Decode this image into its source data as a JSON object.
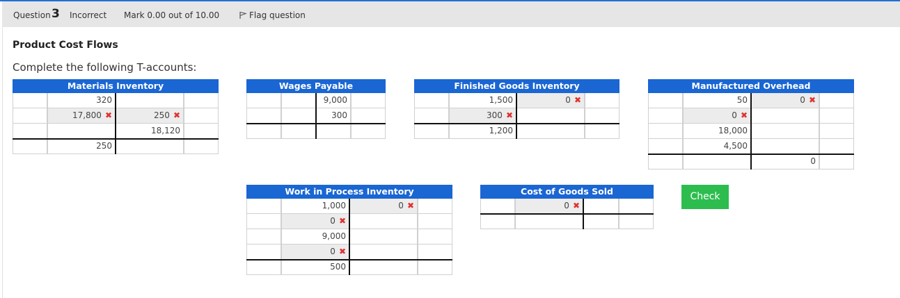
{
  "header": {
    "question_label": "Question",
    "question_number": "3",
    "status": "Incorrect",
    "mark": "Mark 0.00 out of 10.00",
    "flag_label": "Flag question"
  },
  "title": "Product Cost Flows",
  "instructions": "Complete the following T-accounts:",
  "incorrect_mark": "✖",
  "accounts": {
    "materials": {
      "name": "Materials Inventory",
      "rows": [
        {
          "left": "320",
          "right": ""
        },
        {
          "left": "17,800",
          "right": "250"
        },
        {
          "left": "",
          "right": "18,120"
        },
        {
          "left": "250",
          "right": ""
        }
      ]
    },
    "wages": {
      "name": "Wages Payable",
      "rows": [
        {
          "left": "",
          "right": "9,000"
        },
        {
          "left": "",
          "right": "300"
        },
        {
          "left": "",
          "right": ""
        }
      ]
    },
    "finished": {
      "name": "Finished Goods Inventory",
      "rows": [
        {
          "left": "1,500",
          "right": "0"
        },
        {
          "left": "300",
          "right": ""
        },
        {
          "left": "1,200",
          "right": ""
        }
      ]
    },
    "overhead": {
      "name": "Manufactured Overhead",
      "rows": [
        {
          "left": "50",
          "right": "0"
        },
        {
          "left": "0",
          "right": ""
        },
        {
          "left": "18,000",
          "right": ""
        },
        {
          "left": "4,500",
          "right": ""
        },
        {
          "left": "",
          "right": "0"
        }
      ]
    },
    "wip": {
      "name": "Work in Process Inventory",
      "rows": [
        {
          "left": "1,000",
          "right": "0"
        },
        {
          "left": "0",
          "right": ""
        },
        {
          "left": "9,000",
          "right": ""
        },
        {
          "left": "0",
          "right": ""
        },
        {
          "left": "500",
          "right": ""
        }
      ]
    },
    "cogs": {
      "name": "Cost of Goods Sold",
      "rows": [
        {
          "left": "0",
          "right": ""
        },
        {
          "left": "",
          "right": ""
        }
      ]
    }
  },
  "check_label": "Check",
  "colors": {
    "header_blue": "#1a66d3",
    "check_green": "#2dbd4f",
    "error_red": "#e03131"
  }
}
